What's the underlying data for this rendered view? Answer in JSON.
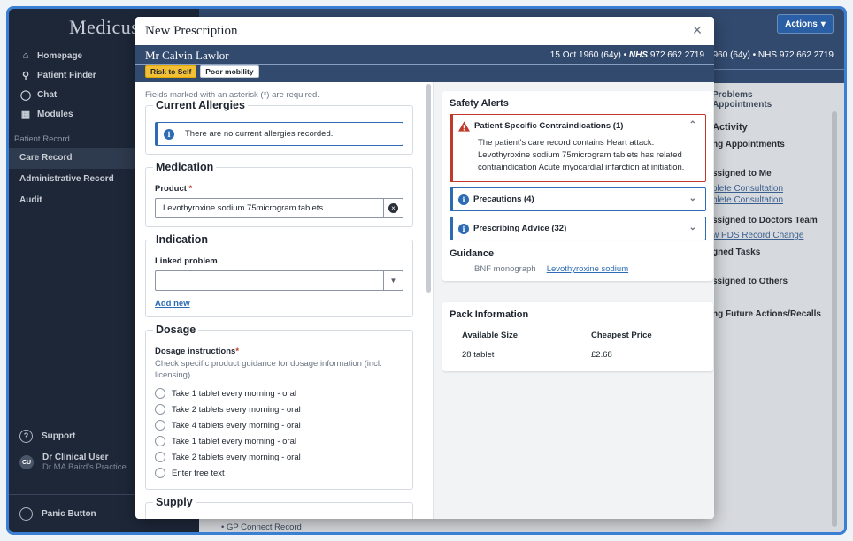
{
  "app": {
    "logo": "Medicus",
    "nav": [
      {
        "label": "Homepage",
        "icon": "home-icon"
      },
      {
        "label": "Patient Finder",
        "icon": "search-icon"
      },
      {
        "label": "Chat",
        "icon": "chat-icon"
      },
      {
        "label": "Modules",
        "icon": "grid-icon"
      }
    ],
    "patient_record_header": "Patient Record",
    "patient_record_items": [
      "Care Record",
      "Administrative Record",
      "Audit"
    ],
    "support": "Support",
    "user_name": "Dr Clinical User",
    "user_practice": "Dr MA Baird's Practice",
    "user_initials": "CU",
    "panic": "Panic Button",
    "actions_button": "Actions",
    "bg_banner_meta": "1960 (64y) • NHS 972 662 2719",
    "bg_tabs": [
      "Problems",
      "Appointments"
    ],
    "bg_activity": {
      "title": "Activity",
      "lines": [
        "ng Appointments",
        "ssigned to Me",
        "ssigned to Doctors Team",
        "gned Tasks",
        "ssigned to Others",
        "ng Future Actions/Recalls"
      ],
      "links_me": [
        "plete Consultation",
        "plete Consultation"
      ],
      "link_team": "w PDS Record Change"
    },
    "bg_bottom_text": "• GP Connect Record"
  },
  "modal": {
    "title": "New Prescription",
    "close_symbol": "×",
    "patient": {
      "name": "Mr Calvin Lawlor",
      "dob": "15 Oct 1960 (64y)",
      "separator": "•",
      "nhs_label": "NHS",
      "nhs_number": "972 662 2719",
      "flags": [
        "Risk to Self",
        "Poor mobility"
      ]
    },
    "required_note": "Fields marked with an asterisk (*) are required.",
    "allergies": {
      "title": "Current Allergies",
      "message": "There are no current allergies recorded."
    },
    "medication": {
      "title": "Medication",
      "product_label": "Product",
      "product_value": "Levothyroxine sodium 75microgram tablets"
    },
    "indication": {
      "title": "Indication",
      "linked_label": "Linked problem",
      "linked_value": "",
      "add_new": "Add new"
    },
    "dosage": {
      "title": "Dosage",
      "instructions_label": "Dosage instructions",
      "hint": "Check specific product guidance for dosage information (incl. licensing).",
      "options": [
        "Take 1 tablet every morning - oral",
        "Take 2 tablets every morning - oral",
        "Take 4 tablets every morning - oral",
        "Take 1 tablet every morning - oral",
        "Take 2 tablets every morning - oral",
        "Enter free text"
      ]
    },
    "supply": {
      "title": "Supply"
    },
    "safety_alerts": {
      "title": "Safety Alerts",
      "contraindications": {
        "title": "Patient Specific Contraindications (1)",
        "body": "The patient's care record contains Heart attack. Levothyroxine sodium 75microgram tablets has related contraindication Acute myocardial infarction at initiation."
      },
      "precautions": "Precautions (4)",
      "prescribing_advice": "Prescribing Advice (32)"
    },
    "guidance": {
      "title": "Guidance",
      "label": "BNF monograph",
      "link": "Levothyroxine sodium"
    },
    "pack": {
      "title": "Pack Information",
      "headers": [
        "Available Size",
        "Cheapest Price"
      ],
      "rows": [
        [
          "28 tablet",
          "£2.68"
        ]
      ]
    }
  },
  "colors": {
    "brand_navy": "#324a6e",
    "sidebar": "#1d2738",
    "link_blue": "#2d6cb5",
    "danger": "#c0392b",
    "flag_yellow": "#f3c035"
  }
}
